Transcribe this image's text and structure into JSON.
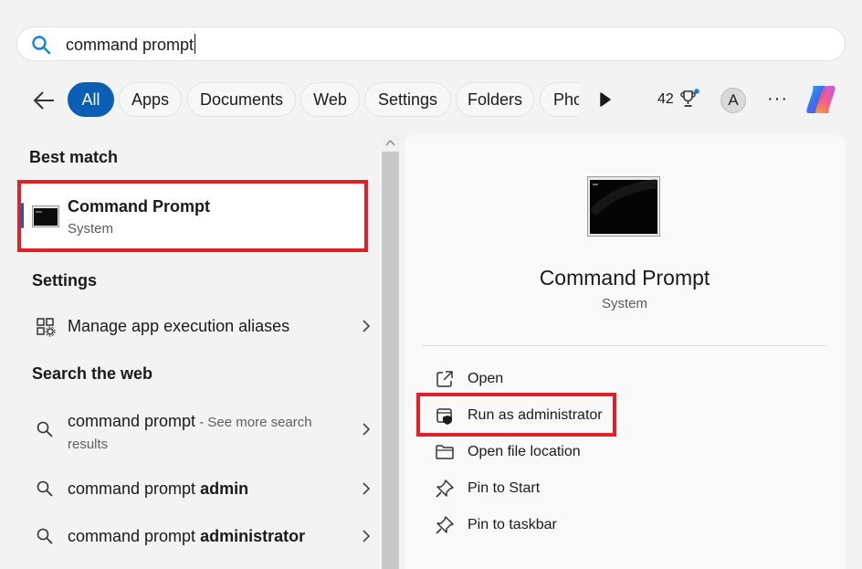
{
  "search": {
    "query": "command prompt"
  },
  "filters": {
    "chips": [
      {
        "label": "All",
        "active": true
      },
      {
        "label": "Apps"
      },
      {
        "label": "Documents"
      },
      {
        "label": "Web"
      },
      {
        "label": "Settings"
      },
      {
        "label": "Folders"
      },
      {
        "label": "Pho"
      }
    ],
    "points": "42",
    "avatar_initial": "A",
    "more_label": "···"
  },
  "results": {
    "best_match_header": "Best match",
    "best_match": {
      "title": "Command Prompt",
      "subtitle": "System"
    },
    "settings_header": "Settings",
    "settings_items": [
      {
        "label": "Manage app execution aliases"
      }
    ],
    "web_header": "Search the web",
    "web_items": [
      {
        "prefix": "command prompt",
        "bold": "",
        "suffix": " - See more search",
        "suffix2": "results"
      },
      {
        "prefix": "command prompt ",
        "bold": "admin"
      },
      {
        "prefix": "command prompt ",
        "bold": "administrator"
      }
    ]
  },
  "details": {
    "title": "Command Prompt",
    "subtitle": "System",
    "actions": [
      {
        "label": "Open",
        "icon": "open-external-icon"
      },
      {
        "label": "Run as administrator",
        "icon": "shield-admin-icon"
      },
      {
        "label": "Open file location",
        "icon": "folder-icon"
      },
      {
        "label": "Pin to Start",
        "icon": "pin-icon"
      },
      {
        "label": "Pin to taskbar",
        "icon": "pin-icon"
      }
    ]
  },
  "colors": {
    "accent": "#0a5fb4",
    "highlight": "#e0202a"
  }
}
